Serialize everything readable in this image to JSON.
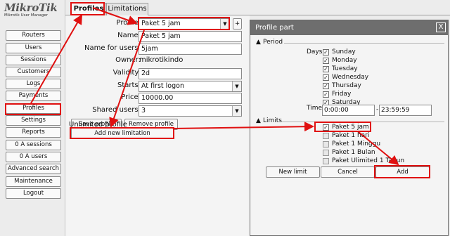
{
  "logo": {
    "name": "MikroTik",
    "sub": "Mikrotik User Manager"
  },
  "sidebar": {
    "items": [
      {
        "label": "Routers"
      },
      {
        "label": "Users"
      },
      {
        "label": "Sessions"
      },
      {
        "label": "Customers"
      },
      {
        "label": "Logs"
      },
      {
        "label": "Payments"
      },
      {
        "label": "Profiles"
      },
      {
        "label": "Settings"
      },
      {
        "label": "Reports"
      },
      {
        "label": "0 A sessions"
      },
      {
        "label": "0 A users"
      },
      {
        "label": "Advanced search"
      },
      {
        "label": "Maintenance"
      },
      {
        "label": "Logout"
      }
    ],
    "selected": "Profiles"
  },
  "tabs": [
    {
      "label": "Profiles"
    },
    {
      "label": "Limitations"
    }
  ],
  "form": {
    "profile_label": "Profile:",
    "profile_value": "Paket 5 jam",
    "name_label": "Name:",
    "name_value": "Paket 5 jam",
    "nameusers_label": "Name for users:",
    "nameusers_value": "5jam",
    "owner_label": "Owner:",
    "owner_value": "mikrotikindo",
    "validity_label": "Validity:",
    "validity_value": "2d",
    "starts_label": "Starts:",
    "starts_value": "At first logon",
    "price_label": "Price:",
    "price_value": "10000.00",
    "shared_label": "Shared users:",
    "shared_value": "3",
    "save_profile": "Save profile",
    "remove_profile": "Remove profile",
    "unlimited_text": "Unlimited profile",
    "add_limitation": "Add new limitation",
    "add_small": "+"
  },
  "dialog": {
    "title": "Profile part",
    "close": "X",
    "period_label": "Period",
    "days_label": "Days:",
    "days": [
      {
        "label": "Sunday",
        "checked": true
      },
      {
        "label": "Monday",
        "checked": true
      },
      {
        "label": "Tuesday",
        "checked": true
      },
      {
        "label": "Wednesday",
        "checked": true
      },
      {
        "label": "Thursday",
        "checked": true
      },
      {
        "label": "Friday",
        "checked": true
      },
      {
        "label": "Saturday",
        "checked": true
      }
    ],
    "time_label": "Time:",
    "time_from": "0:00:00",
    "time_sep": "-",
    "time_to": "23:59:59",
    "limits_label": "Limits",
    "limits": [
      {
        "label": "Paket 5 jam",
        "checked": true
      },
      {
        "label": "Paket 1 hari",
        "checked": false
      },
      {
        "label": "Paket 1 Minggu",
        "checked": false
      },
      {
        "label": "Paket 1 Bulan",
        "checked": false
      },
      {
        "label": "Paket Ulimited 1 Tahun",
        "checked": false
      }
    ],
    "new_limit": "New limit",
    "cancel": "Cancel",
    "add": "Add"
  },
  "colors": {
    "annotation": "#e01010",
    "titlebar": "#6e6e6e"
  },
  "icons": {
    "dropdown": "chevron-down-icon",
    "collapse": "triangle-up-icon",
    "check": "check-icon"
  }
}
